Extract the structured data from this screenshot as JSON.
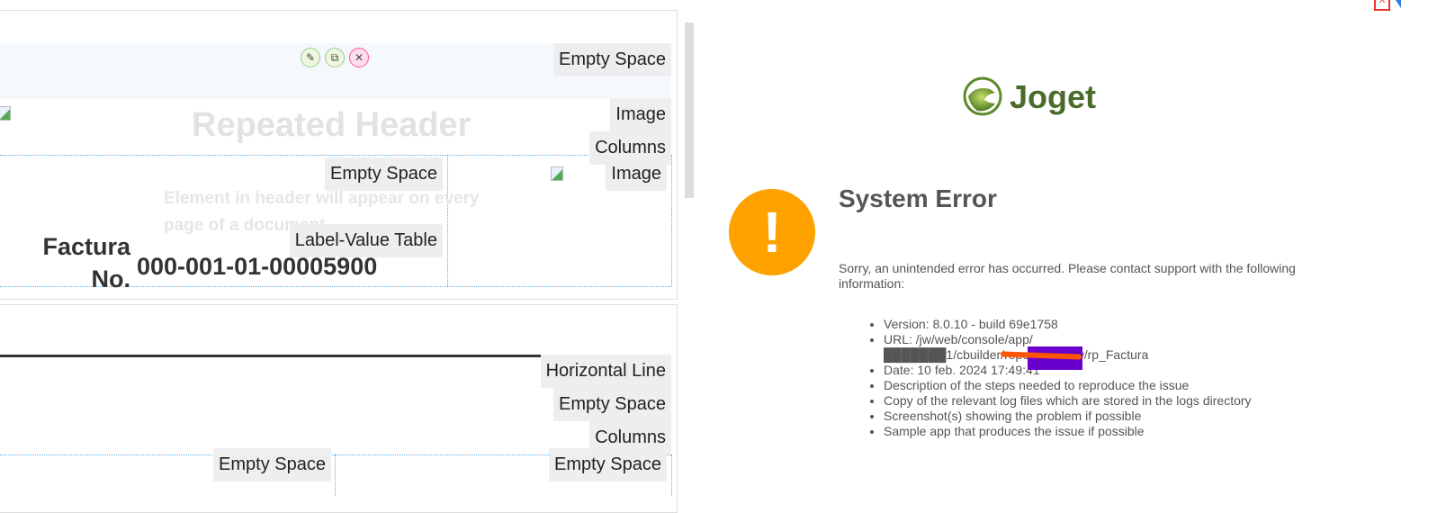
{
  "builder": {
    "actions": {
      "edit": "✎",
      "copy": "⧉",
      "delete": "✕"
    },
    "header_title": "Repeated Header",
    "header_hint": "Element in header will appear on every page of a document",
    "factura_label": "Factura No.",
    "factura_value": "000-001-01-00005900",
    "tags": {
      "empty_space_1": "Empty Space",
      "image_1": "Image",
      "columns_1": "Columns",
      "empty_space_2": "Empty Space",
      "image_2": "Image",
      "label_value_table": "Label-Value Table",
      "horizontal_line": "Horizontal Line",
      "empty_space_3": "Empty Space",
      "columns_2": "Columns",
      "empty_space_4": "Empty Space",
      "empty_space_5": "Empty Space"
    }
  },
  "preview": {
    "logo_text": "Joget",
    "error_title": "System Error",
    "error_message": "Sorry, an unintended error has occurred. Please contact support with the following information:",
    "info_items": [
      "Version: 8.0.10 - build 69e1758",
      "URL: /jw/web/console/app/███████1/cbuilder/report/preview/rp_Factura",
      "Date: 10 feb. 2024 17:49:41",
      "Description of the steps needed to reproduce the issue",
      "Copy of the relevant log files which are stored in the logs directory",
      "Screenshot(s) showing the problem if possible",
      "Sample app that produces the issue if possible"
    ]
  },
  "colors": {
    "accent": "#ffa200",
    "logo": "#4a6b2a",
    "redact_purple": "#6a00cc",
    "redact_orange": "#ff5500"
  }
}
